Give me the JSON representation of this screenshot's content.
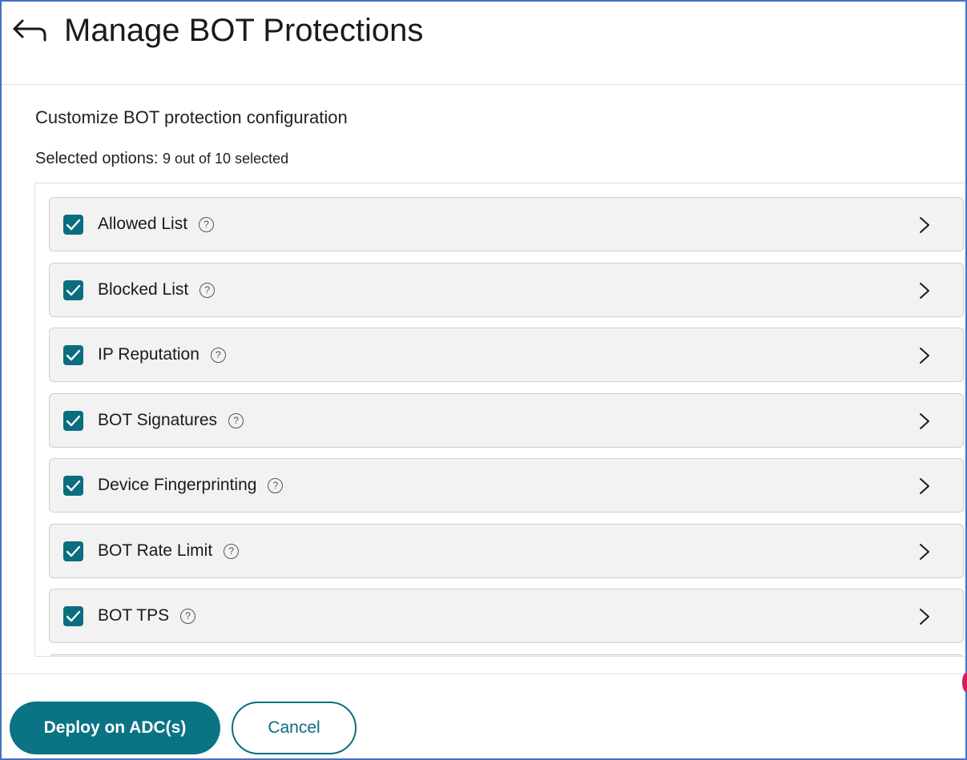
{
  "header": {
    "title": "Manage BOT Protections",
    "back_icon": "back-arrow-icon"
  },
  "content": {
    "subtitle": "Customize BOT protection configuration",
    "selected_label": "Selected options:",
    "selected_count": "9 out of 10 selected",
    "selected_num": 9,
    "total_num": 10
  },
  "protections": [
    {
      "label": "Allowed List",
      "checked": true
    },
    {
      "label": "Blocked List",
      "checked": true
    },
    {
      "label": "IP Reputation",
      "checked": true
    },
    {
      "label": "BOT Signatures",
      "checked": true
    },
    {
      "label": "Device Fingerprinting",
      "checked": true
    },
    {
      "label": "BOT Rate Limit",
      "checked": true
    },
    {
      "label": "BOT TPS",
      "checked": true
    }
  ],
  "help_glyph": "?",
  "footer": {
    "deploy_label": "Deploy on ADC(s)",
    "cancel_label": "Cancel"
  },
  "colors": {
    "accent": "#0a7384",
    "checkbox": "#0a6e80",
    "frame_border": "#4472c4"
  }
}
